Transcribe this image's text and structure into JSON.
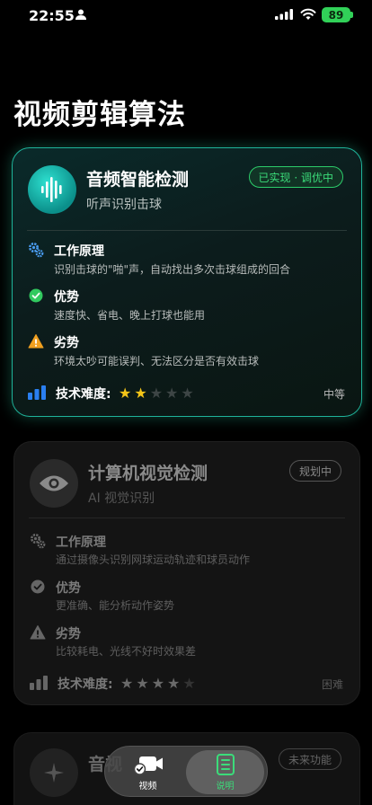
{
  "status": {
    "time": "22:55",
    "battery": "89"
  },
  "page": {
    "title": "视频剪辑算法"
  },
  "cards": [
    {
      "title": "音频智能检测",
      "subtitle": "听声识别击球",
      "badge": "已实现 · 调优中",
      "sections": [
        {
          "title": "工作原理",
          "text": "识别击球的\"啪\"声，自动找出多次击球组成的回合"
        },
        {
          "title": "优势",
          "text": "速度快、省电、晚上打球也能用"
        },
        {
          "title": "劣势",
          "text": "环境太吵可能误判、无法区分是否有效击球"
        }
      ],
      "difficulty_label": "技术难度:",
      "difficulty_stars": 2,
      "difficulty_max": 5,
      "level": "中等"
    },
    {
      "title": "计算机视觉检测",
      "subtitle": "AI 视觉识别",
      "badge": "规划中",
      "sections": [
        {
          "title": "工作原理",
          "text": "通过摄像头识别网球运动轨迹和球员动作"
        },
        {
          "title": "优势",
          "text": "更准确、能分析动作姿势"
        },
        {
          "title": "劣势",
          "text": "比较耗电、光线不好时效果差"
        }
      ],
      "difficulty_label": "技术难度:",
      "difficulty_stars": 4,
      "difficulty_max": 5,
      "level": "困难"
    },
    {
      "title": "音视",
      "badge": "未来功能"
    }
  ],
  "tabs": [
    {
      "label": "视频"
    },
    {
      "label": "说明"
    }
  ],
  "colors": {
    "accent": "#1fb39a",
    "green": "#3bdc7a",
    "star": "#f5c518",
    "warning": "#f0a020"
  }
}
